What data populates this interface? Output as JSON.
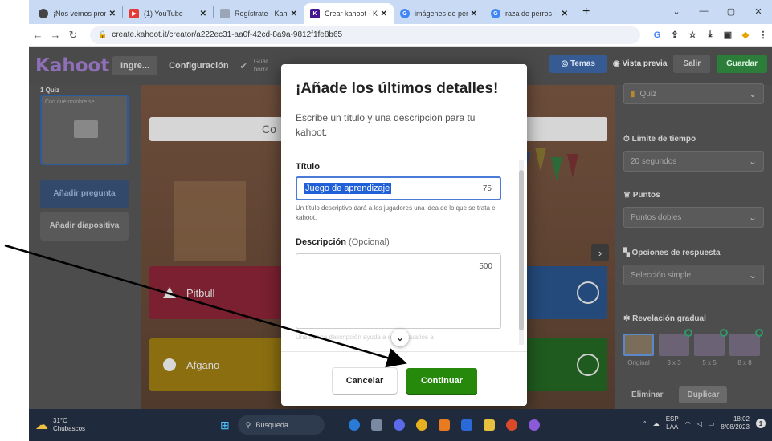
{
  "browser": {
    "tabs": [
      {
        "label": "¡Nos vemos pronto",
        "active": false,
        "color": "#444"
      },
      {
        "label": "(1) YouTube",
        "active": false,
        "color": "#e53935"
      },
      {
        "label": "Regístrate - Kahoot",
        "active": false,
        "color": "#9aa6b8"
      },
      {
        "label": "Crear kahoot - Kah",
        "active": true,
        "color": "#46178f"
      },
      {
        "label": "imágenes de perro",
        "active": false,
        "color": "#4285f4"
      },
      {
        "label": "raza de perros - Bu",
        "active": false,
        "color": "#4285f4"
      }
    ],
    "url": "create.kahoot.it/creator/a222ec31-aa0f-42cd-8a9a-9812f1fe8b65"
  },
  "header": {
    "logo": "Kahoot!",
    "title": "Ingre...",
    "settings": "Configuración",
    "saved_line1": "Guar",
    "saved_line2": "borra",
    "themes": "Temas",
    "preview": "Vista previa",
    "exit": "Salir",
    "save": "Guardar"
  },
  "left": {
    "question_number": "1  Quiz",
    "question_text": "Con qué nombre se...",
    "add_question": "Añadir pregunta",
    "add_slide": "Añadir diapositiva"
  },
  "canvas": {
    "question_text": "Co",
    "answers": [
      "Pitbull",
      "Afgano"
    ]
  },
  "right": {
    "question_type": "Quiz",
    "time_limit_label": "Límite de tiempo",
    "time_limit_value": "20 segundos",
    "points_label": "Puntos",
    "points_value": "Puntos dobles",
    "answer_options_label": "Opciones de respuesta",
    "answer_options_value": "Selección simple",
    "reveal_label": "Revelación gradual",
    "reveal_options": [
      "Original",
      "3 x 3",
      "5 x 5",
      "8 x 8"
    ],
    "delete": "Eliminar",
    "duplicate": "Duplicar"
  },
  "modal": {
    "title": "¡Añade los últimos detalles!",
    "description": "Escribe un título y una descripción para tu kahoot.",
    "title_label": "Título",
    "title_value": "Juego de aprendizaje",
    "title_counter": "75",
    "title_hint": "Un título descriptivo dará a los jugadores una idea de lo que se trata el kahoot.",
    "desc_label": "Descripción",
    "desc_optional": "(Opcional)",
    "desc_counter": "500",
    "desc_hint_faded": "Una buena descripción ayuda a otros usuarios a",
    "cancel": "Cancelar",
    "continue": "Continuar"
  },
  "taskbar": {
    "temperature": "31°C",
    "weather": "Chubascos",
    "search_placeholder": "Búsqueda",
    "lang1": "ESP",
    "lang2": "LAA",
    "time": "18:02",
    "date": "8/08/2023"
  },
  "colors": {
    "continue": "#26890c",
    "kahoot_purple": "#46178f",
    "arrow": "#000000"
  }
}
